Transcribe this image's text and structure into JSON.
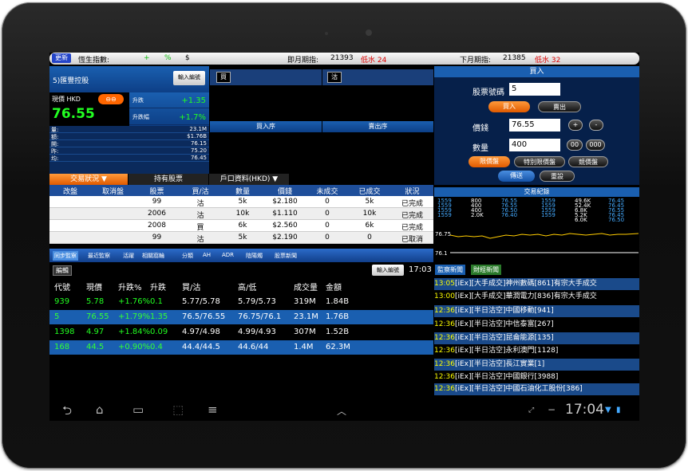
{
  "topbar": {
    "update": "更新",
    "index_label": "恆生指數:",
    "plus": "+",
    "pct": "%",
    "dollar": "$",
    "cur_fut_label": "即月期指:",
    "cur_fut_val": "21393",
    "cur_fut_diff": "低水 24",
    "next_fut_label": "下月期指:",
    "next_fut_val": "21385",
    "next_fut_diff": "低水 32"
  },
  "stock": {
    "name": "5)匯豐控股",
    "input_btn": "輸入編號",
    "price_label": "現價 HKD",
    "toggle": "⊖⊖",
    "price": "76.55",
    "chg_label": "升跌",
    "chg_val": "+1.35",
    "chgpct_label": "升跌幅",
    "chgpct_val": "+1.7%"
  },
  "stats": [
    {
      "k": "量:",
      "v": "23.1M"
    },
    {
      "k": "額:",
      "v": "$1.76B"
    },
    {
      "k": "開:",
      "v": "76.15"
    },
    {
      "k": "昨:",
      "v": "75.20"
    },
    {
      "k": "均:",
      "v": "76.45"
    }
  ],
  "orderbook": {
    "buy": "買",
    "sell": "沽",
    "buy_queue": "買入序",
    "sell_queue": "賣出序"
  },
  "tabs": {
    "trade_status": "交易狀況",
    "holdings": "持有股票",
    "account": "戶口資料(HKD)",
    "arrow": "▼"
  },
  "orders": {
    "headers": [
      "改盤",
      "取消盤",
      "股票",
      "買/沽",
      "數量",
      "價錢",
      "未成交",
      "已成交",
      "狀況"
    ],
    "rows": [
      [
        "",
        "",
        "99",
        "沽",
        "5k",
        "$2.180",
        "0",
        "5k",
        "已完成"
      ],
      [
        "",
        "",
        "2006",
        "沽",
        "10k",
        "$1.110",
        "0",
        "10k",
        "已完成"
      ],
      [
        "",
        "",
        "2008",
        "買",
        "6k",
        "$2.560",
        "0",
        "6k",
        "已完成"
      ],
      [
        "",
        "",
        "99",
        "沽",
        "5k",
        "$2.190",
        "0",
        "0",
        "已取消"
      ]
    ]
  },
  "order_panel": {
    "title": "買入",
    "code_label": "股票號碼",
    "code": "5",
    "buy": "買入",
    "sell": "賣出",
    "price_label": "價錢",
    "price": "76.55",
    "plus": "+",
    "minus": "-",
    "qty_label": "數量",
    "qty": "400",
    "q00": "00",
    "q000": "000",
    "limit": "限價盤",
    "special": "特別限價盤",
    "auction": "競價盤",
    "submit": "傳送",
    "reset": "重設"
  },
  "trades": {
    "title": "交易紀錄",
    "col1": [
      "1559",
      "1559",
      "1559",
      "1559"
    ],
    "col2": [
      "800",
      "400",
      "400",
      "2.0K"
    ],
    "col3": [
      "76.55",
      "76.55",
      "76.50",
      "76.40"
    ],
    "col4": [
      "1559",
      "1559",
      "1559",
      "1559"
    ],
    "col5": [
      "49.6K",
      "52.4K",
      "6.8K",
      "5.2K",
      "6.0K"
    ],
    "col6": [
      "76.45",
      "76.45",
      "76.55",
      "76.45",
      "76.50"
    ],
    "axis_top": "76.75",
    "axis_bot": "76.1"
  },
  "watch_tabs": [
    "同步監察",
    "最近監察",
    "活躍",
    "相關窩輪",
    "分類",
    "AH",
    "ADR",
    "陰陽燭",
    "股票新聞"
  ],
  "watch": {
    "edit": "編輯",
    "input_btn": "輸入編號",
    "time": "17:03",
    "headers": [
      "代號",
      "現價",
      "升跌%",
      "升跌",
      "買/沽",
      "高/低",
      "成交量",
      "金額"
    ],
    "rows": [
      [
        "939",
        "5.78",
        "+1.76%",
        "0.1",
        "5.77/5.78",
        "5.79/5.73",
        "319M",
        "1.84B"
      ],
      [
        "5",
        "76.55",
        "+1.79%",
        "1.35",
        "76.5/76.55",
        "76.75/76.1",
        "23.1M",
        "1.76B"
      ],
      [
        "1398",
        "4.97",
        "+1.84%",
        "0.09",
        "4.97/4.98",
        "4.99/4.93",
        "307M",
        "1.52B"
      ],
      [
        "168",
        "44.5",
        "+0.90%",
        "0.4",
        "44.4/44.5",
        "44.6/44",
        "1.4M",
        "62.3M"
      ]
    ]
  },
  "news": {
    "tab1": "監察新聞",
    "tab2": "財經新聞",
    "items": [
      {
        "t": "13:05",
        "s": "[iEx][大手成交]神州數碼[861]有宗大手成交"
      },
      {
        "t": "13:00",
        "s": "[iEx][大手成交]華潤電力[836]有宗大手成交"
      },
      {
        "t": "12:36",
        "s": "[iEx][半日沽空]中國移動[941]"
      },
      {
        "t": "12:36",
        "s": "[iEx][半日沽空]中信泰富[267]"
      },
      {
        "t": "12:36",
        "s": "[iEx][半日沽空]昆侖能源[135]"
      },
      {
        "t": "12:36",
        "s": "[iEx][半日沽空]永利澳門[1128]"
      },
      {
        "t": "12:36",
        "s": "[iEx][半日沽空]長江實業[1]"
      },
      {
        "t": "12:36",
        "s": "[iEx][半日沽空]中國銀行[3988]"
      },
      {
        "t": "12:36",
        "s": "[iEx][半日沽空]中國石油化工股份[386]"
      }
    ]
  },
  "nav": {
    "clock": "17:04"
  }
}
